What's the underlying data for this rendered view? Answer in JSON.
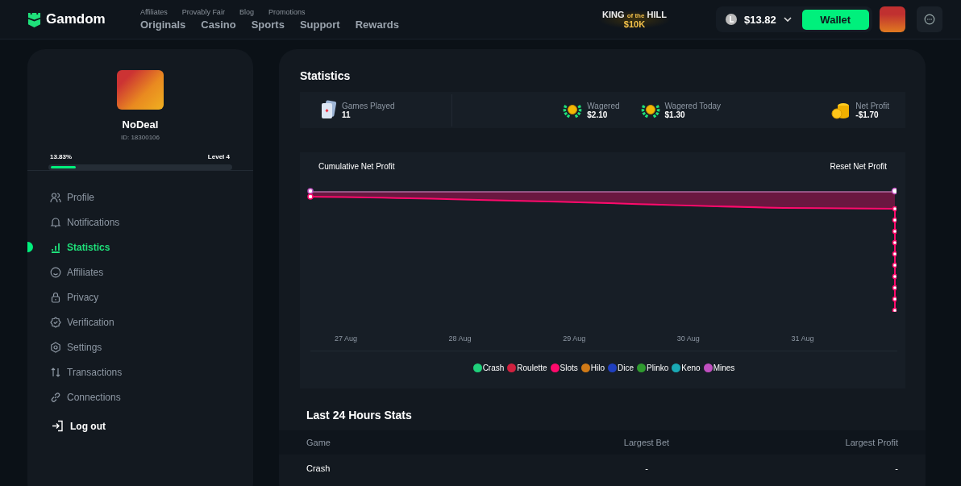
{
  "header": {
    "brand": "Gamdom",
    "top_links": [
      "Affiliates",
      "Provably Fair",
      "Blog",
      "Promotions"
    ],
    "nav": [
      "Originals",
      "Casino",
      "Sports",
      "Support",
      "Rewards"
    ],
    "promo": {
      "line1a": "KING",
      "line1b": "of the",
      "line1c": "HILL",
      "line2": "$10K"
    },
    "balance": "$13.82",
    "wallet_button": "Wallet"
  },
  "profile": {
    "username": "NoDeal",
    "id": "ID: 18300106",
    "progress_text": "13.83%",
    "level_text": "Level 4",
    "level": 0.1383
  },
  "sidebar": {
    "items": [
      {
        "label": "Profile",
        "selected": false
      },
      {
        "label": "Notifications",
        "selected": false
      },
      {
        "label": "Statistics",
        "selected": true
      },
      {
        "label": "Affiliates",
        "selected": false
      },
      {
        "label": "Privacy",
        "selected": false
      },
      {
        "label": "Verification",
        "selected": false
      },
      {
        "label": "Settings",
        "selected": false
      },
      {
        "label": "Transactions",
        "selected": false
      },
      {
        "label": "Connections",
        "selected": false
      }
    ],
    "logout": "Log out"
  },
  "statistics": {
    "title": "Statistics",
    "summary": [
      {
        "label": "Games Played",
        "value": "11",
        "kind": "cards"
      },
      {
        "label": "Wagered",
        "value": "$2.10",
        "kind": "wreath"
      },
      {
        "label": "Wagered Today",
        "value": "$1.30",
        "kind": "wreath"
      },
      {
        "label": "Net Profit",
        "value": "-$1.70",
        "kind": "coins"
      }
    ],
    "chart": {
      "title": "Cumulative Net Profit",
      "reset_button": "Reset Net Profit",
      "x_labels": [
        "27 Aug",
        "28 Aug",
        "29 Aug",
        "30 Aug",
        "31 Aug"
      ],
      "legend": [
        {
          "label": "Crash",
          "color": "#1fd07a"
        },
        {
          "label": "Roulette",
          "color": "#d0213f"
        },
        {
          "label": "Slots",
          "color": "#ff0a6c"
        },
        {
          "label": "Hilo",
          "color": "#d07a17"
        },
        {
          "label": "Dice",
          "color": "#1f3fbf"
        },
        {
          "label": "Plinko",
          "color": "#2f9a2f"
        },
        {
          "label": "Keno",
          "color": "#1aa9b5"
        },
        {
          "label": "Mines",
          "color": "#c04fc0"
        }
      ]
    }
  },
  "last_24h": {
    "title": "Last 24 Hours Stats",
    "columns": [
      "Game",
      "Largest Bet",
      "Largest Profit"
    ],
    "rows": [
      [
        "Crash",
        "-",
        "-"
      ]
    ]
  }
}
